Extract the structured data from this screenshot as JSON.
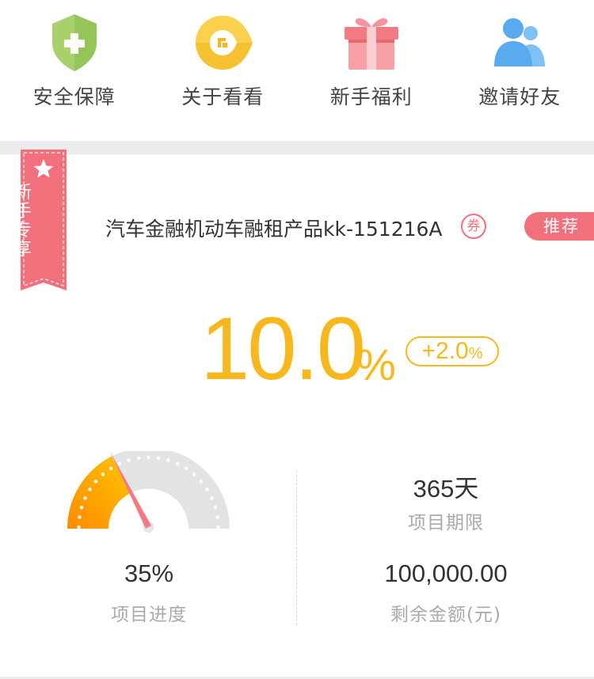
{
  "quick_nav": [
    {
      "label": "安全保障",
      "icon": "shield-plus-icon",
      "color": "#a8d06b"
    },
    {
      "label": "关于看看",
      "icon": "brand-logo-icon",
      "color": "#f7c232"
    },
    {
      "label": "新手福利",
      "icon": "gift-icon",
      "color": "#f27a83"
    },
    {
      "label": "邀请好友",
      "icon": "users-icon",
      "color": "#5aaaf0"
    }
  ],
  "product": {
    "ribbon_label": [
      "新",
      "手",
      "专",
      "享"
    ],
    "name": "汽车金融机动车融租产品kk-151216A",
    "coupon_badge": "券",
    "recommend_tag": "推荐",
    "rate": "10.0",
    "rate_unit": "%",
    "bonus_rate": "+2.0",
    "bonus_unit": "%"
  },
  "stats": {
    "progress_value": "35%",
    "progress_fraction": 0.35,
    "progress_label": "项目进度",
    "term_value": "365天",
    "term_label": "项目期限",
    "remaining_value": "100,000.00",
    "remaining_label": "剩余金额(元)"
  },
  "colors": {
    "accent_yellow": "#f7b81d",
    "accent_pink": "#f26f7c",
    "gauge_orange": "#ff8a00",
    "gauge_gray": "#e3e3e3"
  }
}
